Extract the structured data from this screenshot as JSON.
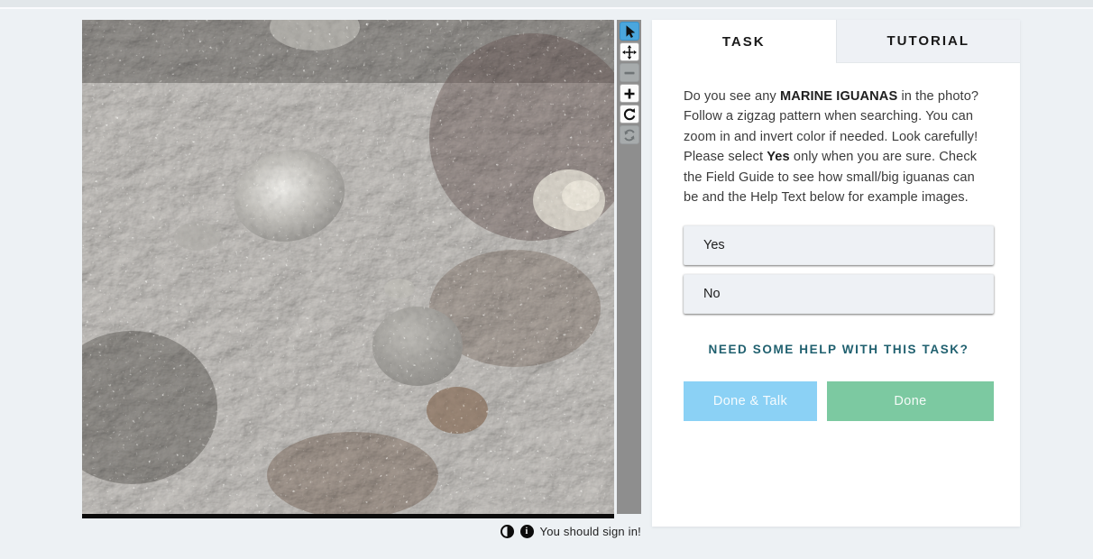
{
  "viewer": {
    "toolbar": [
      {
        "name": "pointer-tool",
        "state": "selected"
      },
      {
        "name": "pan-tool",
        "state": "enabled"
      },
      {
        "name": "zoom-out-tool",
        "state": "disabled"
      },
      {
        "name": "zoom-in-tool",
        "state": "enabled"
      },
      {
        "name": "rotate-tool",
        "state": "enabled"
      },
      {
        "name": "reset-tool",
        "state": "disabled"
      }
    ],
    "footer": {
      "icons": [
        "invert-contrast-icon",
        "info-icon"
      ],
      "info_glyph": "i",
      "sign_in_message": "You should sign in!"
    },
    "photo_description": "aerial close-up of gray volcanic rocks with white guano speckles"
  },
  "panel": {
    "tabs": [
      {
        "label": "TASK",
        "active": true
      },
      {
        "label": "TUTORIAL",
        "active": false
      }
    ],
    "task": {
      "segments": [
        {
          "text": "Do you see any ",
          "bold": false
        },
        {
          "text": "MARINE IGUANAS",
          "bold": true
        },
        {
          "text": " in the photo? Follow a zigzag pattern when searching. You can zoom in and invert color if needed. Look carefully! Please select ",
          "bold": false
        },
        {
          "text": "Yes",
          "bold": true
        },
        {
          "text": " only when you are sure. Check the Field Guide to see how small/big iguanas can be and the Help Text below for example images.",
          "bold": false
        }
      ],
      "answers": [
        {
          "label": "Yes"
        },
        {
          "label": "No"
        }
      ],
      "help_link": "NEED SOME HELP WITH THIS TASK?",
      "done_talk_label": "Done & Talk",
      "done_label": "Done"
    }
  },
  "colors": {
    "page_background": "#edf1f4",
    "panel_background": "#ffffff",
    "inactive_tab_background": "#eef1f5",
    "selected_tool_blue": "#4aa6dd",
    "toolbar_strip_gray": "#8e8e8e",
    "answer_button_background": "#eef1f5",
    "help_link_teal": "#20606f",
    "done_talk_blue": "#8bd1f5",
    "done_green": "#7cc9a1"
  }
}
